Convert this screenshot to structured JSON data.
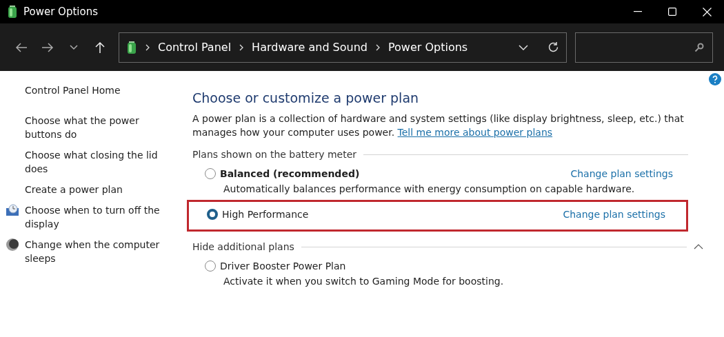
{
  "window": {
    "title": "Power Options"
  },
  "address_bar": {
    "crumbs": [
      "Control Panel",
      "Hardware and Sound",
      "Power Options"
    ]
  },
  "sidebar": {
    "items": [
      {
        "label": "Control Panel Home",
        "kind": "home"
      },
      {
        "label": "Choose what the power buttons do",
        "kind": "plain"
      },
      {
        "label": "Choose what closing the lid does",
        "kind": "plain"
      },
      {
        "label": "Create a power plan",
        "kind": "plain"
      },
      {
        "label": "Choose when to turn off the display",
        "kind": "display"
      },
      {
        "label": "Change when the computer sleeps",
        "kind": "sleep"
      }
    ]
  },
  "main": {
    "title": "Choose or customize a power plan",
    "intro": "A power plan is a collection of hardware and system settings (like display brightness, sleep, etc.) that manages how your computer uses power.",
    "intro_link": "Tell me more about power plans",
    "groups": [
      {
        "title": "Plans shown on the battery meter",
        "kind": "plain",
        "plans": [
          {
            "name": "Balanced (recommended)",
            "bold": true,
            "selected": false,
            "highlighted": false,
            "description": "Automatically balances performance with energy consumption on capable hardware.",
            "link": "Change plan settings"
          },
          {
            "name": "High Performance",
            "bold": false,
            "selected": true,
            "highlighted": true,
            "link": "Change plan settings"
          }
        ]
      },
      {
        "title": "Hide additional plans",
        "kind": "collapsible",
        "plans": [
          {
            "name": "Driver Booster Power Plan",
            "bold": false,
            "selected": false,
            "highlighted": false,
            "description": "Activate it when you switch to Gaming Mode for boosting."
          }
        ]
      }
    ]
  }
}
